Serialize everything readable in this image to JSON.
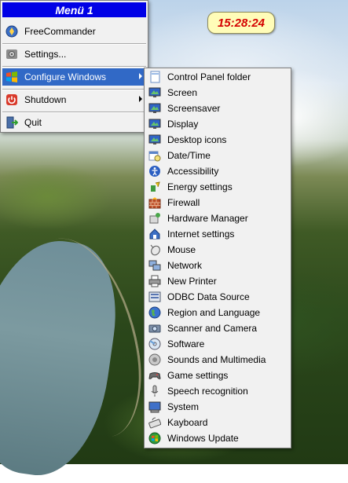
{
  "clock": {
    "time": "15:28:24"
  },
  "main_menu": {
    "title": "Menü 1",
    "items": [
      {
        "label": "FreeCommander",
        "icon": "freecommander-icon"
      },
      {
        "label": "Settings...",
        "icon": "settings-icon"
      },
      {
        "label": "Configure Windows",
        "icon": "windows-logo-icon",
        "submenu": true,
        "selected": true
      },
      {
        "label": "Shutdown",
        "icon": "power-icon",
        "submenu": true
      },
      {
        "label": "Quit",
        "icon": "quit-icon"
      }
    ]
  },
  "submenu": {
    "items": [
      {
        "label": "Control Panel folder",
        "icon": "folder-page-icon"
      },
      {
        "label": "Screen",
        "icon": "monitor-icon"
      },
      {
        "label": "Screensaver",
        "icon": "monitor-icon"
      },
      {
        "label": "Display",
        "icon": "monitor-icon"
      },
      {
        "label": "Desktop icons",
        "icon": "monitor-icon"
      },
      {
        "label": "Date/Time",
        "icon": "calendar-clock-icon"
      },
      {
        "label": "Accessibility",
        "icon": "accessibility-icon"
      },
      {
        "label": "Energy settings",
        "icon": "energy-icon"
      },
      {
        "label": "Firewall",
        "icon": "firewall-icon"
      },
      {
        "label": "Hardware Manager",
        "icon": "hardware-icon"
      },
      {
        "label": "Internet settings",
        "icon": "internet-icon"
      },
      {
        "label": "Mouse",
        "icon": "mouse-icon"
      },
      {
        "label": "Network",
        "icon": "network-icon"
      },
      {
        "label": "New Printer",
        "icon": "printer-icon"
      },
      {
        "label": "ODBC Data Source",
        "icon": "odbc-icon"
      },
      {
        "label": "Region and Language",
        "icon": "globe-icon"
      },
      {
        "label": "Scanner and Camera",
        "icon": "scanner-icon"
      },
      {
        "label": "Software",
        "icon": "software-icon"
      },
      {
        "label": "Sounds and Multimedia",
        "icon": "speaker-icon"
      },
      {
        "label": "Game settings",
        "icon": "gamepad-icon"
      },
      {
        "label": "Speech recognition",
        "icon": "microphone-icon"
      },
      {
        "label": "System",
        "icon": "system-icon"
      },
      {
        "label": "Kayboard",
        "icon": "keyboard-icon"
      },
      {
        "label": "Windows Update",
        "icon": "windows-update-icon"
      }
    ]
  },
  "colors": {
    "menu_title_bg": "#0000e6",
    "highlight": "#3169c6",
    "clock_text": "#d40000",
    "clock_bg": "#fffcb8"
  }
}
